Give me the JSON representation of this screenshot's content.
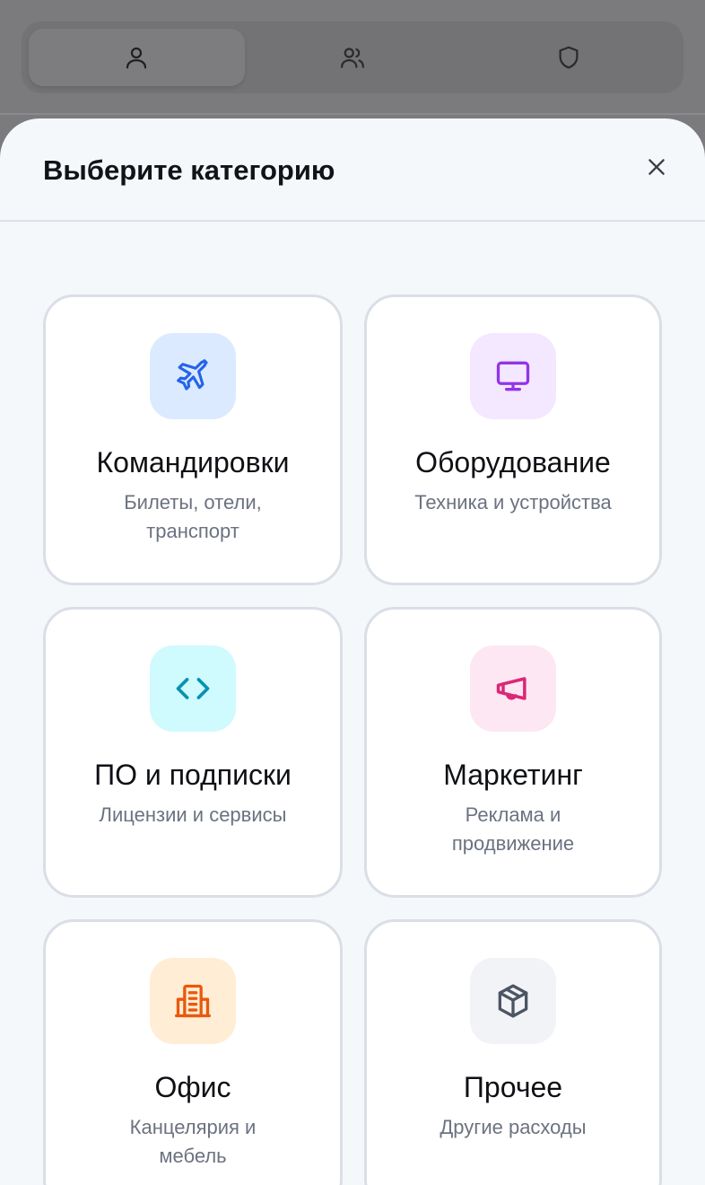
{
  "tabs": [
    {
      "icon": "user-icon",
      "active": true
    },
    {
      "icon": "users-icon",
      "active": false
    },
    {
      "icon": "shield-icon",
      "active": false
    }
  ],
  "sheet": {
    "title": "Выберите категорию",
    "close_icon": "close-icon"
  },
  "categories": [
    {
      "id": "travel",
      "title": "Командировки",
      "subtitle": "Билеты, отели, транспорт",
      "icon": "airplane-icon",
      "tile_bg": "#dbeafe",
      "color": "#2563eb"
    },
    {
      "id": "equipment",
      "title": "Оборудование",
      "subtitle": "Техника и устройства",
      "icon": "monitor-icon",
      "tile_bg": "#f3e8ff",
      "color": "#9333ea"
    },
    {
      "id": "software",
      "title": "ПО и подписки",
      "subtitle": "Лицензии и сервисы",
      "icon": "code-icon",
      "tile_bg": "#cffafe",
      "color": "#0891b2"
    },
    {
      "id": "marketing",
      "title": "Маркетинг",
      "subtitle": "Реклама и продвижение",
      "icon": "megaphone-icon",
      "tile_bg": "#fce7f3",
      "color": "#db2777"
    },
    {
      "id": "office",
      "title": "Офис",
      "subtitle": "Канцелярия и мебель",
      "icon": "building-icon",
      "tile_bg": "#ffedd5",
      "color": "#ea580c"
    },
    {
      "id": "other",
      "title": "Прочее",
      "subtitle": "Другие расходы",
      "icon": "package-icon",
      "tile_bg": "#f1f3f7",
      "color": "#4b5563"
    }
  ]
}
